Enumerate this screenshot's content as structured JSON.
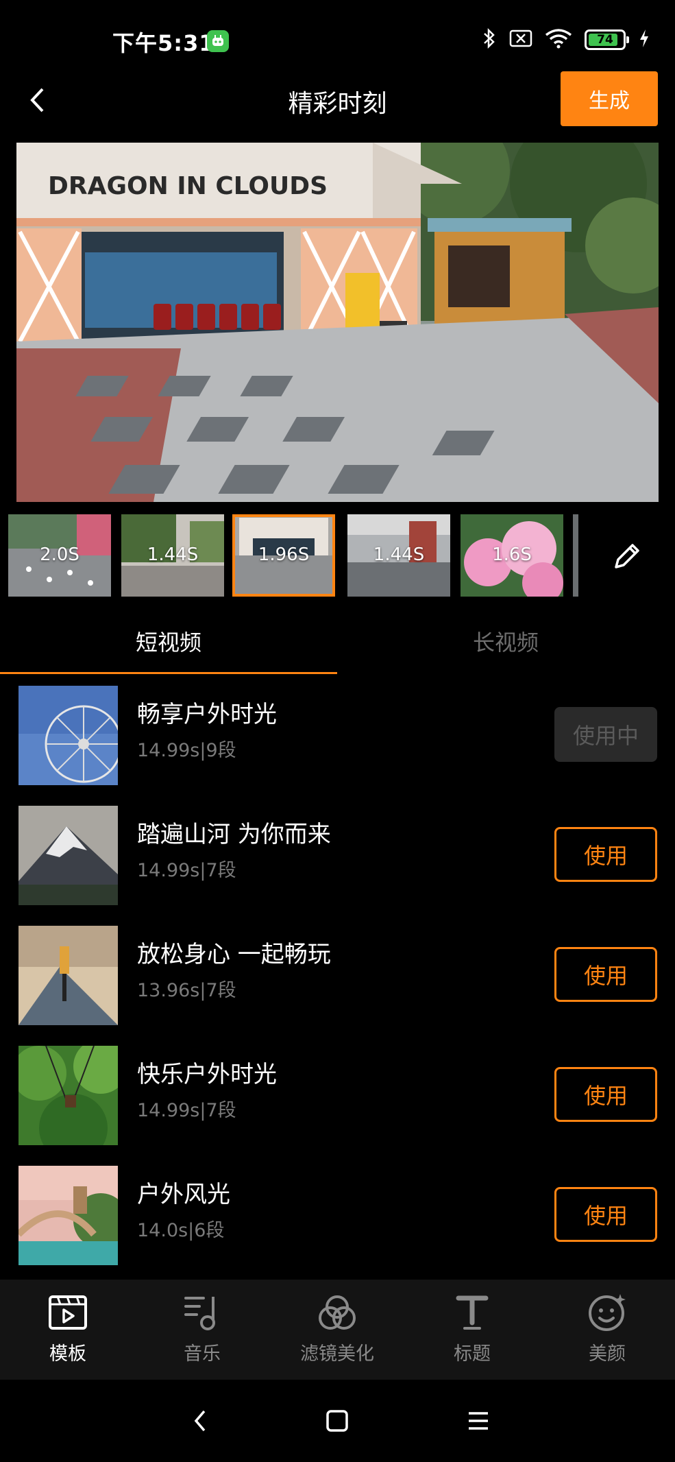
{
  "status_bar": {
    "time": "下午5:31",
    "battery": "74"
  },
  "header": {
    "title": "精彩时刻",
    "generate_label": "生成"
  },
  "preview": {
    "sign_text": "DRAGON IN CLOUDS"
  },
  "clips": [
    {
      "duration": "2.0S"
    },
    {
      "duration": "1.44S"
    },
    {
      "duration": "1.96S"
    },
    {
      "duration": "1.44S"
    },
    {
      "duration": "1.6S"
    }
  ],
  "tabs": [
    {
      "label": "短视频"
    },
    {
      "label": "长视频"
    }
  ],
  "templates": [
    {
      "title": "畅享户外时光",
      "meta": "14.99s|9段",
      "button": "使用中"
    },
    {
      "title": "踏遍山河 为你而来",
      "meta": "14.99s|7段",
      "button": "使用"
    },
    {
      "title": "放松身心 一起畅玩",
      "meta": "13.96s|7段",
      "button": "使用"
    },
    {
      "title": "快乐户外时光",
      "meta": "14.99s|7段",
      "button": "使用"
    },
    {
      "title": "户外风光",
      "meta": "14.0s|6段",
      "button": "使用"
    }
  ],
  "bottom_nav": [
    {
      "label": "模板",
      "icon": "template-icon"
    },
    {
      "label": "音乐",
      "icon": "music-icon"
    },
    {
      "label": "滤镜美化",
      "icon": "filter-icon"
    },
    {
      "label": "标题",
      "icon": "title-icon"
    },
    {
      "label": "美颜",
      "icon": "beauty-icon"
    }
  ],
  "colors": {
    "accent": "#ff8412",
    "background": "#000000"
  }
}
